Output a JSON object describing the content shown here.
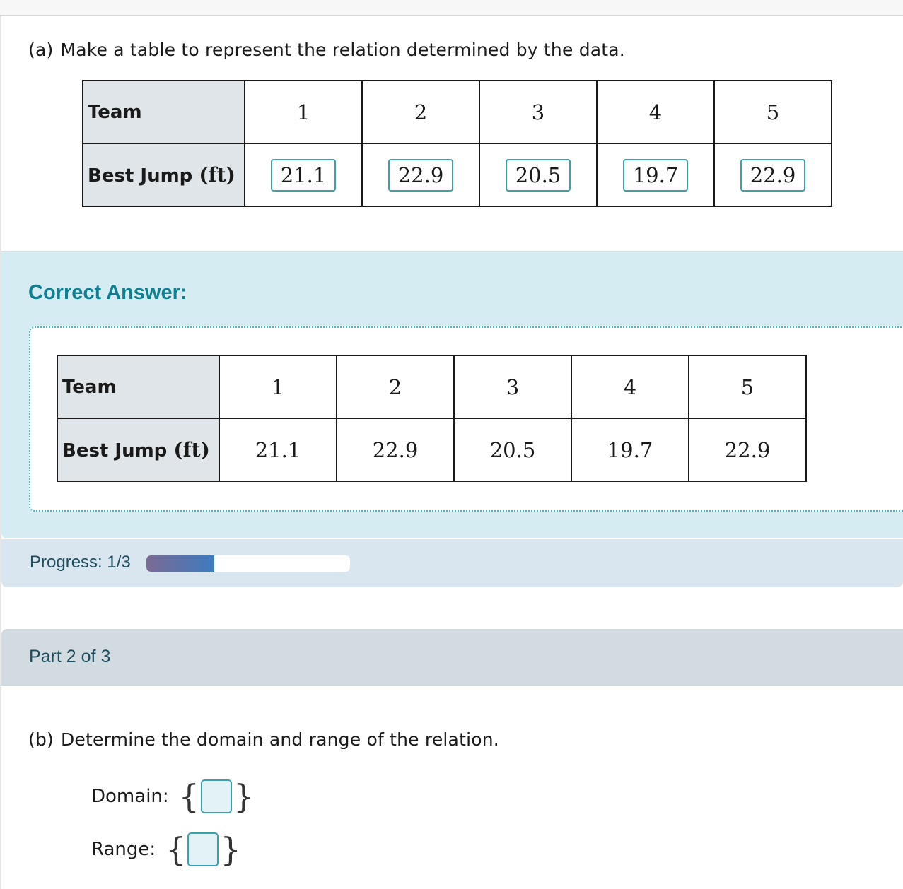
{
  "part_a": {
    "label": "(a)",
    "prompt": "Make a table to represent the relation determined by the data.",
    "table": {
      "row1_header": "Team",
      "row2_header": "Best Jump",
      "row2_unit": "(ft)",
      "teams": [
        "1",
        "2",
        "3",
        "4",
        "5"
      ],
      "jumps": [
        "21.1",
        "22.9",
        "20.5",
        "19.7",
        "22.9"
      ]
    }
  },
  "correct_answer": {
    "title": "Correct Answer:",
    "table": {
      "row1_header": "Team",
      "row2_header": "Best Jump",
      "row2_unit": "(ft)",
      "teams": [
        "1",
        "2",
        "3",
        "4",
        "5"
      ],
      "jumps": [
        "21.1",
        "22.9",
        "20.5",
        "19.7",
        "22.9"
      ]
    }
  },
  "progress": {
    "label": "Progress: 1/3",
    "fraction": 0.3333
  },
  "part_header": "Part 2 of 3",
  "part_b": {
    "label": "(b)",
    "prompt": "Determine the domain and range of the relation.",
    "domain_label": "Domain:",
    "domain_value": "",
    "range_label": "Range:",
    "range_value": "",
    "brace_open": "{",
    "brace_close": "}"
  }
}
